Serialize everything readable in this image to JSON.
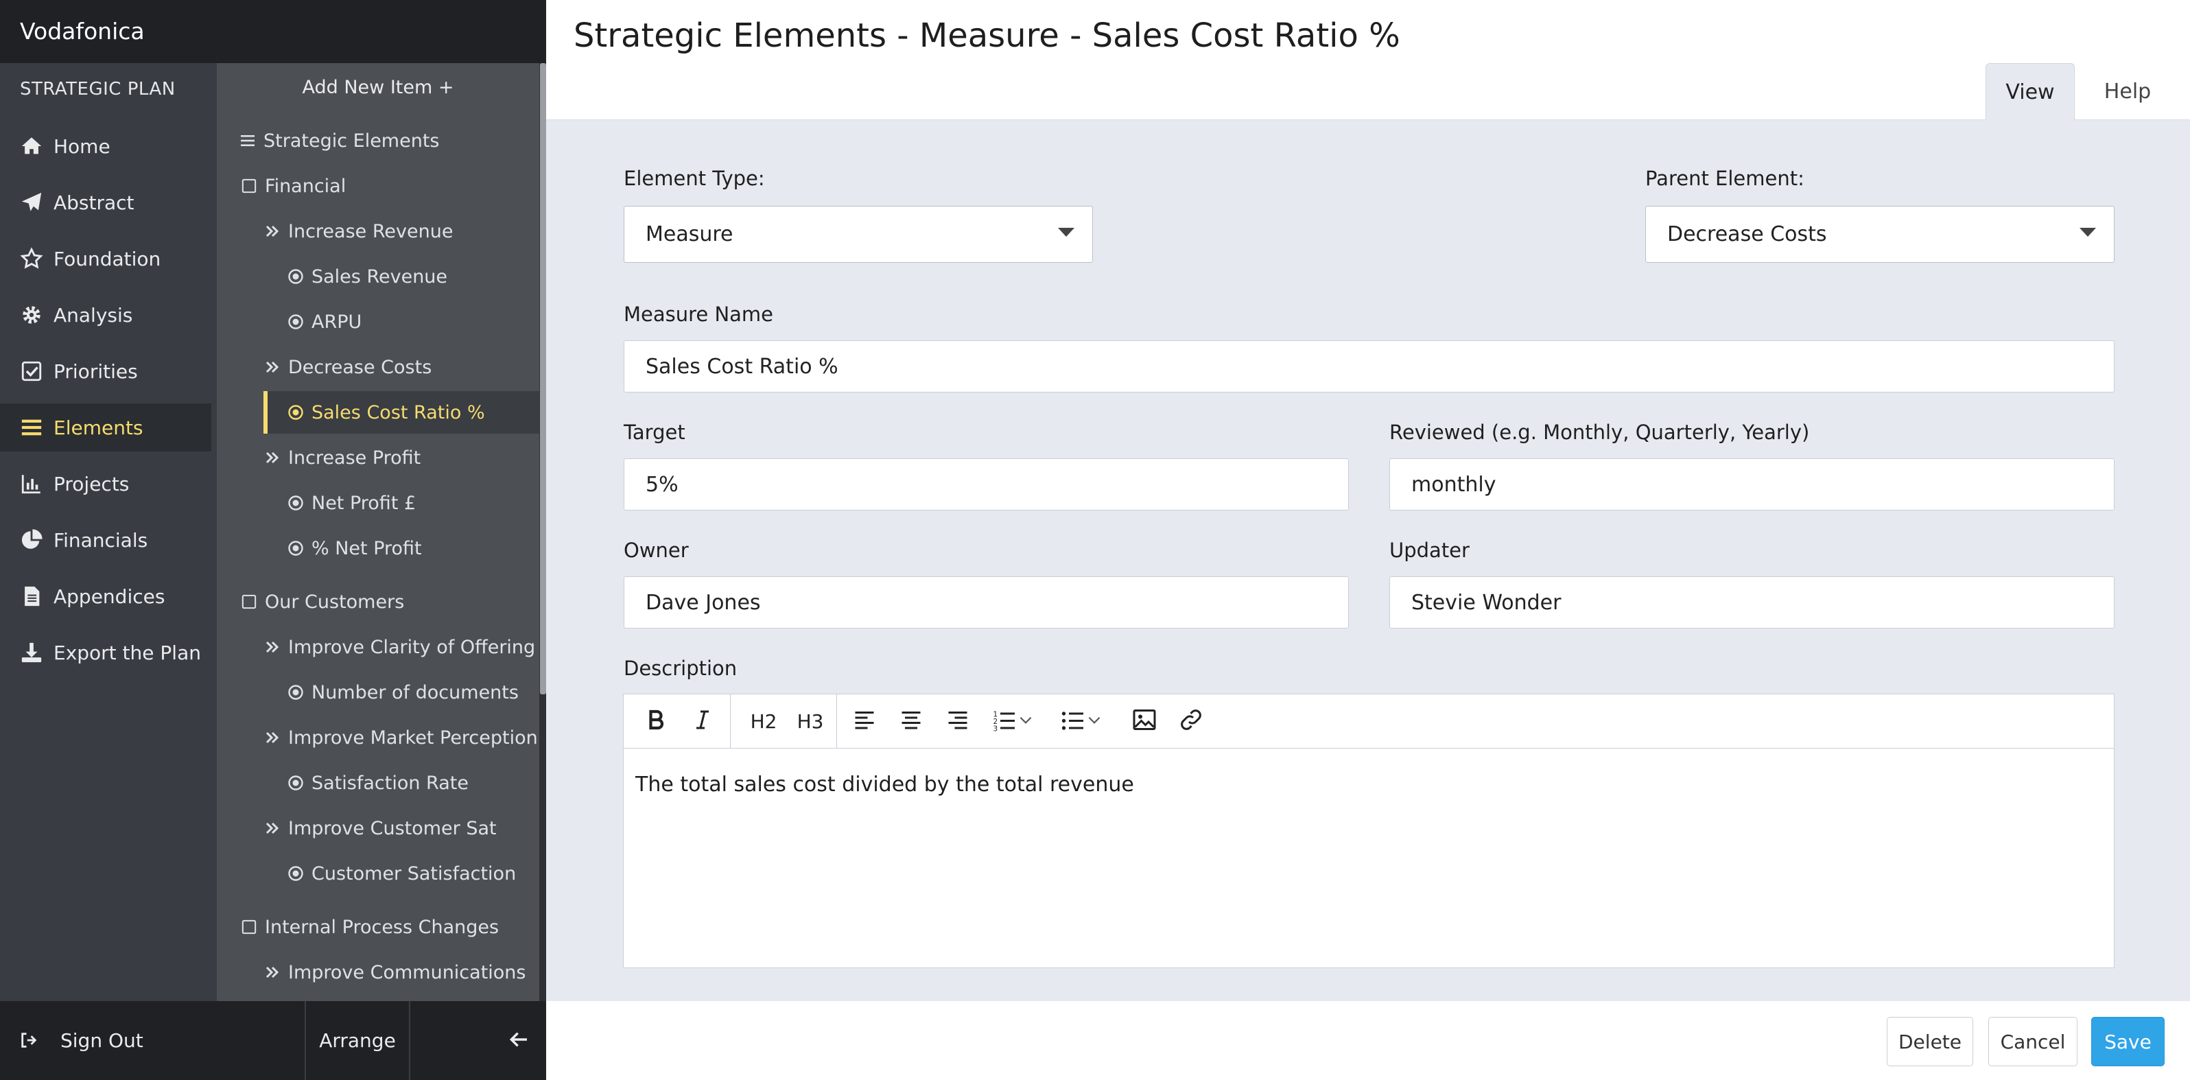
{
  "app": {
    "brand": "Vodafonica",
    "section_heading": "STRATEGIC PLAN"
  },
  "nav": {
    "items": [
      {
        "label": "Home",
        "icon": "home-icon"
      },
      {
        "label": "Abstract",
        "icon": "paper-plane-icon"
      },
      {
        "label": "Foundation",
        "icon": "star-icon"
      },
      {
        "label": "Analysis",
        "icon": "gear-icon"
      },
      {
        "label": "Priorities",
        "icon": "checkbox-icon"
      },
      {
        "label": "Elements",
        "icon": "list-icon",
        "active": true
      },
      {
        "label": "Projects",
        "icon": "bar-chart-icon"
      },
      {
        "label": "Financials",
        "icon": "pie-chart-icon"
      },
      {
        "label": "Appendices",
        "icon": "document-icon"
      },
      {
        "label": "Export the Plan",
        "icon": "download-icon"
      }
    ],
    "sign_out": "Sign Out",
    "arrange": "Arrange"
  },
  "tree": {
    "add_new": "Add New Item +",
    "items": [
      {
        "label": "Strategic Elements",
        "type": "root"
      },
      {
        "label": "Financial",
        "type": "perspective"
      },
      {
        "label": "Increase Revenue",
        "type": "objective"
      },
      {
        "label": "Sales Revenue",
        "type": "measure"
      },
      {
        "label": "ARPU",
        "type": "measure"
      },
      {
        "label": "Decrease Costs",
        "type": "objective"
      },
      {
        "label": "Sales Cost Ratio %",
        "type": "measure",
        "active": true
      },
      {
        "label": "Increase Profit",
        "type": "objective"
      },
      {
        "label": "Net Profit £",
        "type": "measure"
      },
      {
        "label": "% Net Profit",
        "type": "measure"
      },
      {
        "label": "Our Customers",
        "type": "perspective"
      },
      {
        "label": "Improve Clarity of Offering",
        "type": "objective"
      },
      {
        "label": "Number of documents",
        "type": "measure"
      },
      {
        "label": "Improve Market Perception",
        "type": "objective"
      },
      {
        "label": "Satisfaction Rate",
        "type": "measure"
      },
      {
        "label": "Improve Customer Sat",
        "type": "objective"
      },
      {
        "label": "Customer Satisfaction",
        "type": "measure"
      },
      {
        "label": "Internal Process Changes",
        "type": "perspective"
      },
      {
        "label": "Improve Communications",
        "type": "objective"
      }
    ]
  },
  "header": {
    "title": "Strategic Elements - Measure - Sales Cost Ratio %",
    "tabs": [
      "View",
      "Help"
    ]
  },
  "form": {
    "element_type": {
      "label": "Element Type:",
      "value": "Measure"
    },
    "parent_element": {
      "label": "Parent Element:",
      "value": "Decrease Costs"
    },
    "measure_name": {
      "label": "Measure Name",
      "value": "Sales Cost Ratio %"
    },
    "target": {
      "label": "Target",
      "value": "5%"
    },
    "reviewed": {
      "label": "Reviewed (e.g. Monthly, Quarterly, Yearly)",
      "value": "monthly"
    },
    "owner": {
      "label": "Owner",
      "value": "Dave Jones"
    },
    "updater": {
      "label": "Updater",
      "value": "Stevie Wonder"
    },
    "description": {
      "label": "Description",
      "toolbar": {
        "h2": "H2",
        "h3": "H3"
      },
      "value": "The total sales cost divided by the total revenue"
    }
  },
  "footer": {
    "delete": "Delete",
    "cancel": "Cancel",
    "save": "Save"
  },
  "colors": {
    "accent": "#f7dc6f",
    "save": "#2fa4e7",
    "nav_bg": "#393d43",
    "tree_bg": "#4c5055",
    "content_bg": "#e6eaf0"
  }
}
